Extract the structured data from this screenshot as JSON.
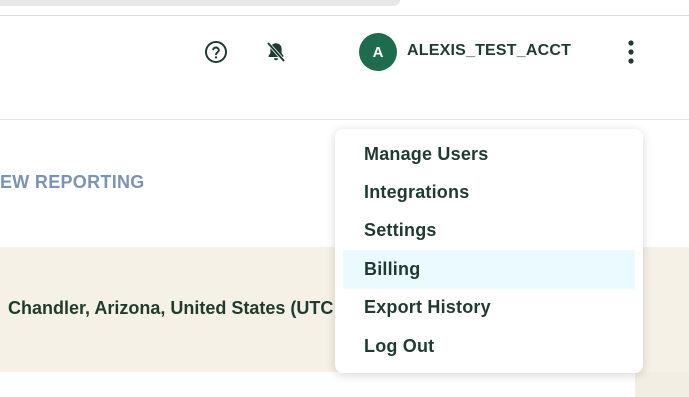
{
  "header": {
    "help_icon": "question-circle-icon",
    "notifications_icon": "bell-off-icon",
    "avatar_initial": "A",
    "account_name": "ALEXIS_TEST_ACCT",
    "more_icon": "kebab-vertical-icon"
  },
  "subnav": {
    "reporting_label": "EW REPORTING"
  },
  "banner": {
    "location": "Chandler, Arizona, United States (UTC"
  },
  "menu": {
    "items": [
      {
        "label": "Manage Users"
      },
      {
        "label": "Integrations"
      },
      {
        "label": "Settings"
      },
      {
        "label": "Billing",
        "highlighted": true
      },
      {
        "label": "Export History"
      },
      {
        "label": "Log Out"
      }
    ]
  },
  "colors": {
    "accent": "#1f6b4e",
    "text": "#1f3b30",
    "link_muted": "#7b93b4",
    "banner_bg": "#f6f1e7",
    "menu_highlight": "#eafaff"
  }
}
